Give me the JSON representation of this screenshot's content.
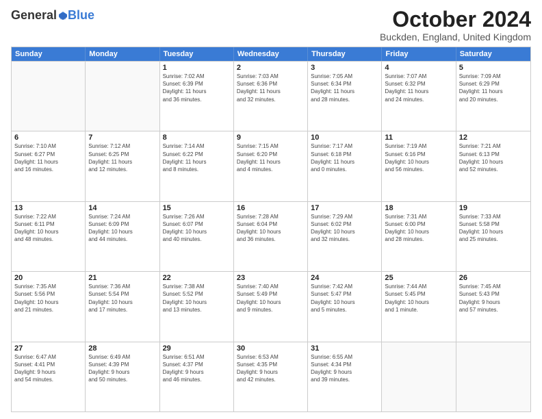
{
  "header": {
    "logo_general": "General",
    "logo_blue": "Blue",
    "month_title": "October 2024",
    "location": "Buckden, England, United Kingdom"
  },
  "weekdays": [
    "Sunday",
    "Monday",
    "Tuesday",
    "Wednesday",
    "Thursday",
    "Friday",
    "Saturday"
  ],
  "weeks": [
    [
      {
        "day": "",
        "info": ""
      },
      {
        "day": "",
        "info": ""
      },
      {
        "day": "1",
        "info": "Sunrise: 7:02 AM\nSunset: 6:39 PM\nDaylight: 11 hours\nand 36 minutes."
      },
      {
        "day": "2",
        "info": "Sunrise: 7:03 AM\nSunset: 6:36 PM\nDaylight: 11 hours\nand 32 minutes."
      },
      {
        "day": "3",
        "info": "Sunrise: 7:05 AM\nSunset: 6:34 PM\nDaylight: 11 hours\nand 28 minutes."
      },
      {
        "day": "4",
        "info": "Sunrise: 7:07 AM\nSunset: 6:32 PM\nDaylight: 11 hours\nand 24 minutes."
      },
      {
        "day": "5",
        "info": "Sunrise: 7:09 AM\nSunset: 6:29 PM\nDaylight: 11 hours\nand 20 minutes."
      }
    ],
    [
      {
        "day": "6",
        "info": "Sunrise: 7:10 AM\nSunset: 6:27 PM\nDaylight: 11 hours\nand 16 minutes."
      },
      {
        "day": "7",
        "info": "Sunrise: 7:12 AM\nSunset: 6:25 PM\nDaylight: 11 hours\nand 12 minutes."
      },
      {
        "day": "8",
        "info": "Sunrise: 7:14 AM\nSunset: 6:22 PM\nDaylight: 11 hours\nand 8 minutes."
      },
      {
        "day": "9",
        "info": "Sunrise: 7:15 AM\nSunset: 6:20 PM\nDaylight: 11 hours\nand 4 minutes."
      },
      {
        "day": "10",
        "info": "Sunrise: 7:17 AM\nSunset: 6:18 PM\nDaylight: 11 hours\nand 0 minutes."
      },
      {
        "day": "11",
        "info": "Sunrise: 7:19 AM\nSunset: 6:16 PM\nDaylight: 10 hours\nand 56 minutes."
      },
      {
        "day": "12",
        "info": "Sunrise: 7:21 AM\nSunset: 6:13 PM\nDaylight: 10 hours\nand 52 minutes."
      }
    ],
    [
      {
        "day": "13",
        "info": "Sunrise: 7:22 AM\nSunset: 6:11 PM\nDaylight: 10 hours\nand 48 minutes."
      },
      {
        "day": "14",
        "info": "Sunrise: 7:24 AM\nSunset: 6:09 PM\nDaylight: 10 hours\nand 44 minutes."
      },
      {
        "day": "15",
        "info": "Sunrise: 7:26 AM\nSunset: 6:07 PM\nDaylight: 10 hours\nand 40 minutes."
      },
      {
        "day": "16",
        "info": "Sunrise: 7:28 AM\nSunset: 6:04 PM\nDaylight: 10 hours\nand 36 minutes."
      },
      {
        "day": "17",
        "info": "Sunrise: 7:29 AM\nSunset: 6:02 PM\nDaylight: 10 hours\nand 32 minutes."
      },
      {
        "day": "18",
        "info": "Sunrise: 7:31 AM\nSunset: 6:00 PM\nDaylight: 10 hours\nand 28 minutes."
      },
      {
        "day": "19",
        "info": "Sunrise: 7:33 AM\nSunset: 5:58 PM\nDaylight: 10 hours\nand 25 minutes."
      }
    ],
    [
      {
        "day": "20",
        "info": "Sunrise: 7:35 AM\nSunset: 5:56 PM\nDaylight: 10 hours\nand 21 minutes."
      },
      {
        "day": "21",
        "info": "Sunrise: 7:36 AM\nSunset: 5:54 PM\nDaylight: 10 hours\nand 17 minutes."
      },
      {
        "day": "22",
        "info": "Sunrise: 7:38 AM\nSunset: 5:52 PM\nDaylight: 10 hours\nand 13 minutes."
      },
      {
        "day": "23",
        "info": "Sunrise: 7:40 AM\nSunset: 5:49 PM\nDaylight: 10 hours\nand 9 minutes."
      },
      {
        "day": "24",
        "info": "Sunrise: 7:42 AM\nSunset: 5:47 PM\nDaylight: 10 hours\nand 5 minutes."
      },
      {
        "day": "25",
        "info": "Sunrise: 7:44 AM\nSunset: 5:45 PM\nDaylight: 10 hours\nand 1 minute."
      },
      {
        "day": "26",
        "info": "Sunrise: 7:45 AM\nSunset: 5:43 PM\nDaylight: 9 hours\nand 57 minutes."
      }
    ],
    [
      {
        "day": "27",
        "info": "Sunrise: 6:47 AM\nSunset: 4:41 PM\nDaylight: 9 hours\nand 54 minutes."
      },
      {
        "day": "28",
        "info": "Sunrise: 6:49 AM\nSunset: 4:39 PM\nDaylight: 9 hours\nand 50 minutes."
      },
      {
        "day": "29",
        "info": "Sunrise: 6:51 AM\nSunset: 4:37 PM\nDaylight: 9 hours\nand 46 minutes."
      },
      {
        "day": "30",
        "info": "Sunrise: 6:53 AM\nSunset: 4:35 PM\nDaylight: 9 hours\nand 42 minutes."
      },
      {
        "day": "31",
        "info": "Sunrise: 6:55 AM\nSunset: 4:34 PM\nDaylight: 9 hours\nand 39 minutes."
      },
      {
        "day": "",
        "info": ""
      },
      {
        "day": "",
        "info": ""
      }
    ]
  ]
}
